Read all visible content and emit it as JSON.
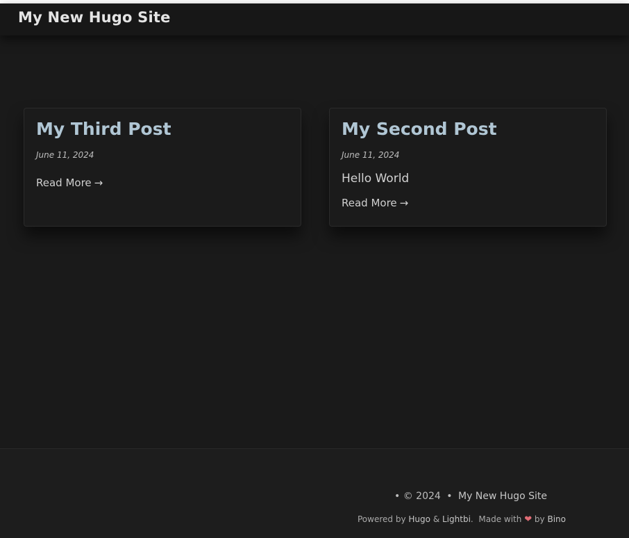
{
  "site": {
    "title": "My New Hugo Site"
  },
  "posts": [
    {
      "title": "My Third Post",
      "date": "June 11, 2024",
      "summary": "",
      "read_more": "Read More"
    },
    {
      "title": "My Second Post",
      "date": "June 11, 2024",
      "summary": "Hello World",
      "read_more": "Read More"
    }
  ],
  "footer": {
    "bullet": "•",
    "copyright": "© 2024",
    "separator": "•",
    "site_name": "My New Hugo Site",
    "powered_by": "Powered by",
    "hugo": "Hugo",
    "amp": "&",
    "lightbi": "Lightbi",
    "period": ".",
    "made_with": "Made with",
    "by": "by",
    "author": "Bino"
  },
  "icons": {
    "read_more_arrow": "arrow-right-icon",
    "heart": "heart-icon"
  },
  "colors": {
    "background": "#1a1a1a",
    "post_title": "#b0c6d4",
    "heart": "#e06c75"
  }
}
